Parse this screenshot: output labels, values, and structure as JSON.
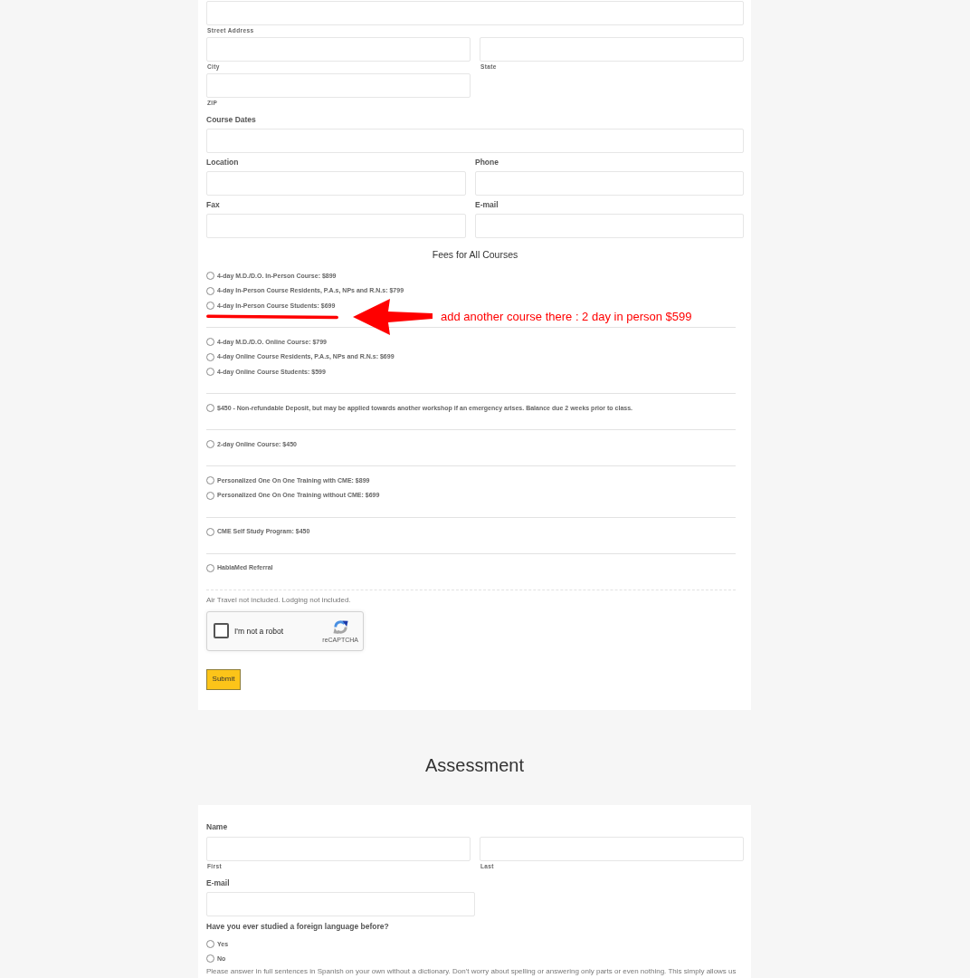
{
  "address_fields": [
    {
      "kind": "wide",
      "sublabel": "Street Address"
    },
    {
      "kind": "half",
      "sublabel": "City"
    },
    {
      "kind": "half",
      "sublabel": "State"
    },
    {
      "kind": "half",
      "sublabel": "ZIP"
    }
  ],
  "contact_fields": [
    {
      "kind": "wide",
      "label": "Course Dates"
    },
    {
      "kind": "half",
      "label": "Location"
    },
    {
      "kind": "half",
      "label": "Phone"
    },
    {
      "kind": "half",
      "label": "Fax"
    },
    {
      "kind": "half",
      "label": "E-mail"
    }
  ],
  "fees": {
    "title": "Fees for All Courses",
    "groups": [
      {
        "options": [
          {
            "label": "4-day M.D./D.O. In-Person Course: $899",
            "selected": false
          },
          {
            "label": "4-day In-Person Course Residents, P.A.s, NPs and R.N.s: $799",
            "selected": false
          },
          {
            "label": "4-day In-Person Course Students: $699",
            "selected": false
          }
        ],
        "annotation": {
          "text": "add another course there : 2 day in person $599"
        }
      },
      {
        "options": [
          {
            "label": "4-day M.D./D.O. Online Course: $799",
            "selected": false
          },
          {
            "label": "4-day Online Course Residents, P.A.s, NPs and R.N.s: $699",
            "selected": false
          },
          {
            "label": "4-day Online Course Students: $599",
            "selected": false
          }
        ]
      },
      {
        "options": [
          {
            "label": "$450 - Non-refundable Deposit, but may be applied towards another workshop if an emergency arises. Balance due 2 weeks prior to class.",
            "selected": false
          }
        ]
      },
      {
        "options": [
          {
            "label": "2-day Online Course: $450",
            "selected": false
          }
        ]
      },
      {
        "options": [
          {
            "label": "Personalized One On One Training with CME: $899",
            "selected": false
          },
          {
            "label": "Personalized One On One Training without CME: $699",
            "selected": false
          }
        ]
      },
      {
        "options": [
          {
            "label": "CME Self Study Program: $450",
            "selected": false
          }
        ]
      },
      {
        "options": [
          {
            "label": "HablaMed Referral",
            "selected": false
          }
        ]
      }
    ]
  },
  "note": "Air Travel not included. Lodging not included.",
  "captcha": {
    "label": "I'm not a robot",
    "brand": "reCAPTCHA",
    "checked": false
  },
  "submit": "Submit",
  "assessment": {
    "title": "Assessment",
    "name": {
      "label": "Name",
      "parts": [
        {
          "sublabel": "First"
        },
        {
          "sublabel": "Last"
        }
      ]
    },
    "email": {
      "label": "E-mail"
    },
    "question": {
      "label": "Have you ever studied a foreign language before?",
      "options": [
        {
          "label": "Yes",
          "selected": false
        },
        {
          "label": "No",
          "selected": false
        }
      ]
    },
    "instructions": "Please answer in full sentences in Spanish on your own without a dictionary. Don't worry about spelling or answering only parts or even nothing. This simply allows us"
  }
}
